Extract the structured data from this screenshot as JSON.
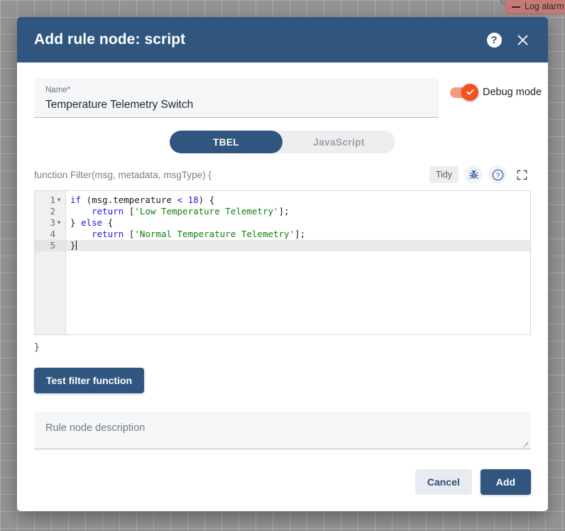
{
  "background": {
    "node_label": "Log alarm"
  },
  "dialog": {
    "title": "Add rule node: script",
    "help_icon_glyph": "?",
    "close_icon_glyph": "✕"
  },
  "form": {
    "name_label": "Name*",
    "name_value": "Temperature Telemetry Switch",
    "debug_label": "Debug mode",
    "debug_enabled": true,
    "description_placeholder": "Rule node description",
    "description_value": ""
  },
  "language_tabs": {
    "options": [
      "TBEL",
      "JavaScript"
    ],
    "selected": "TBEL"
  },
  "editor": {
    "function_signature": "function Filter(msg, metadata, msgType) {",
    "closing_brace": "}",
    "tools": {
      "tidy_label": "Tidy",
      "debug_icon": "bug-icon",
      "help_icon": "help-circle-icon",
      "fullscreen_icon": "fullscreen-icon"
    },
    "lines": [
      {
        "number": "1",
        "foldable": true,
        "active": false,
        "tokens": [
          {
            "t": "kw",
            "s": "if"
          },
          {
            "t": "pl",
            "s": " (msg.temperature "
          },
          {
            "t": "kw",
            "s": "<"
          },
          {
            "t": "pl",
            "s": " "
          },
          {
            "t": "num",
            "s": "18"
          },
          {
            "t": "pl",
            "s": ") {"
          }
        ]
      },
      {
        "number": "2",
        "foldable": false,
        "active": false,
        "tokens": [
          {
            "t": "pl",
            "s": "    "
          },
          {
            "t": "kw",
            "s": "return"
          },
          {
            "t": "pl",
            "s": " ["
          },
          {
            "t": "str",
            "s": "'Low Temperature Telemetry'"
          },
          {
            "t": "pl",
            "s": "];"
          }
        ]
      },
      {
        "number": "3",
        "foldable": true,
        "active": false,
        "tokens": [
          {
            "t": "pl",
            "s": "} "
          },
          {
            "t": "kw",
            "s": "else"
          },
          {
            "t": "pl",
            "s": " {"
          }
        ]
      },
      {
        "number": "4",
        "foldable": false,
        "active": false,
        "tokens": [
          {
            "t": "pl",
            "s": "    "
          },
          {
            "t": "kw",
            "s": "return"
          },
          {
            "t": "pl",
            "s": " ["
          },
          {
            "t": "str",
            "s": "'Normal Temperature Telemetry'"
          },
          {
            "t": "pl",
            "s": "];"
          }
        ]
      },
      {
        "number": "5",
        "foldable": false,
        "active": true,
        "tokens": [
          {
            "t": "pl",
            "s": "}"
          }
        ]
      }
    ]
  },
  "actions": {
    "test_filter_label": "Test filter function",
    "cancel_label": "Cancel",
    "add_label": "Add"
  },
  "colors": {
    "header_blue": "#305680",
    "accent_orange": "#f4511e",
    "field_bg": "#f4f6f8",
    "canvas_gray": "#949494"
  }
}
